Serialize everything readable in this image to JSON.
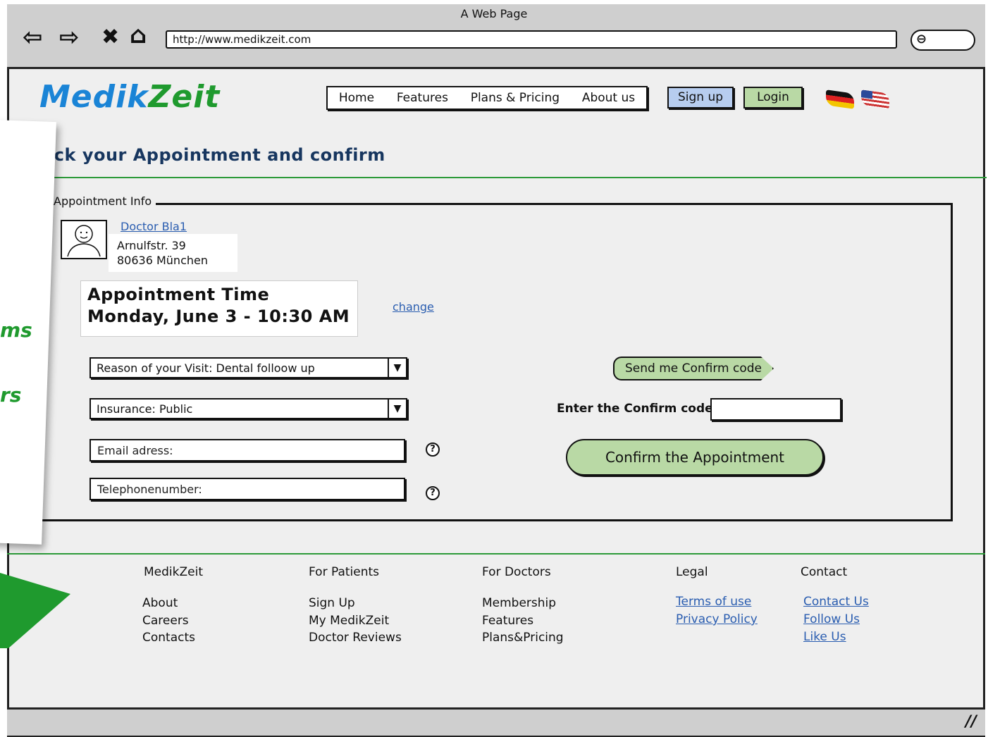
{
  "window": {
    "title": "A Web Page",
    "url": "http://www.medikzeit.com"
  },
  "toolbar_icons": [
    "back-arrow-icon",
    "forward-arrow-icon",
    "close-x-icon",
    "home-icon",
    "search-icon"
  ],
  "logo": {
    "part1": "Medik",
    "part2": "Zeit"
  },
  "nav": {
    "items": [
      "Home",
      "Features",
      "Plans & Pricing",
      "About us"
    ],
    "signup": "Sign up",
    "login": "Login"
  },
  "page": {
    "title": "eck your Appointment and confirm"
  },
  "appointment_info": {
    "legend": "Appointment Info",
    "doctor": "Doctor Bla1",
    "address_line1": "Arnulfstr. 39",
    "address_line2": "80636 München",
    "time_heading": "Appointment Time",
    "time_value": "Monday, June 3 - 10:30 AM",
    "change_link": "change"
  },
  "form": {
    "reason": "Reason of your Visit: Dental folloow up",
    "insurance": "Insurance: Public",
    "email_placeholder": "Email adress:",
    "phone_placeholder": "Telephonenumber:",
    "help_symbol": "?"
  },
  "confirm": {
    "send_code": "Send me Confirm code",
    "code_label": "Enter the Confirm code",
    "confirm_button": "Confirm the Appointment"
  },
  "footer": {
    "col1": {
      "heading": "MedikZeit",
      "items": [
        "About",
        "Careers",
        "Contacts"
      ]
    },
    "col2": {
      "heading": "For Patients",
      "items": [
        "Sign Up",
        "My MedikZeit",
        "Doctor Reviews"
      ]
    },
    "col3": {
      "heading": "For Doctors",
      "items": [
        "Membership",
        "Features",
        "Plans&Pricing"
      ]
    },
    "col4": {
      "heading": "Legal",
      "links": [
        "Terms of use",
        "Privacy Policy"
      ]
    },
    "col5": {
      "heading": "Contact",
      "links": [
        "Contact Us",
        "Follow Us",
        "Like Us"
      ]
    }
  },
  "overlay": {
    "text1": "ms",
    "text2": "rs"
  },
  "colors": {
    "brand_blue": "#1a84d6",
    "brand_green": "#1f9a2e",
    "button_green": "#b9d9a5",
    "button_blue": "#b7cdef",
    "link": "#2a5db0",
    "title": "#17365f"
  }
}
